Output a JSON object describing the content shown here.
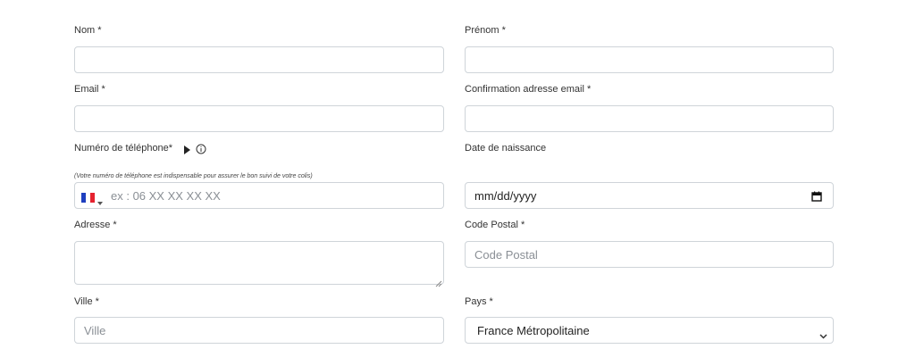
{
  "form": {
    "nom": {
      "label": "Nom *",
      "value": ""
    },
    "prenom": {
      "label": "Prénom *",
      "value": ""
    },
    "email": {
      "label": "Email *",
      "value": ""
    },
    "email_confirm": {
      "label": "Confirmation adresse email *",
      "value": ""
    },
    "phone": {
      "label": "Numéro de téléphone*",
      "note": "(Votre numéro de téléphone est indispensable pour assurer le bon suivi de votre colis)",
      "placeholder": "ex : 06 XX XX XX XX",
      "country_flag": "fr-flag-icon",
      "expand_icon": "triangle-right-icon",
      "info_icon": "info-circle-icon"
    },
    "birthdate": {
      "label": "Date de naissance",
      "placeholder": "mm/dd/yyyy",
      "icon": "calendar-icon"
    },
    "address": {
      "label": "Adresse *",
      "value": ""
    },
    "postal_code": {
      "label": "Code Postal *",
      "placeholder": "Code Postal"
    },
    "city": {
      "label": "Ville *",
      "placeholder": "Ville"
    },
    "country": {
      "label": "Pays *",
      "selected": "France Métropolitaine",
      "icon": "chevron-down-icon"
    }
  },
  "colors": {
    "border": "#cfd4d9",
    "placeholder": "#8a8f95",
    "label": "#333333"
  }
}
